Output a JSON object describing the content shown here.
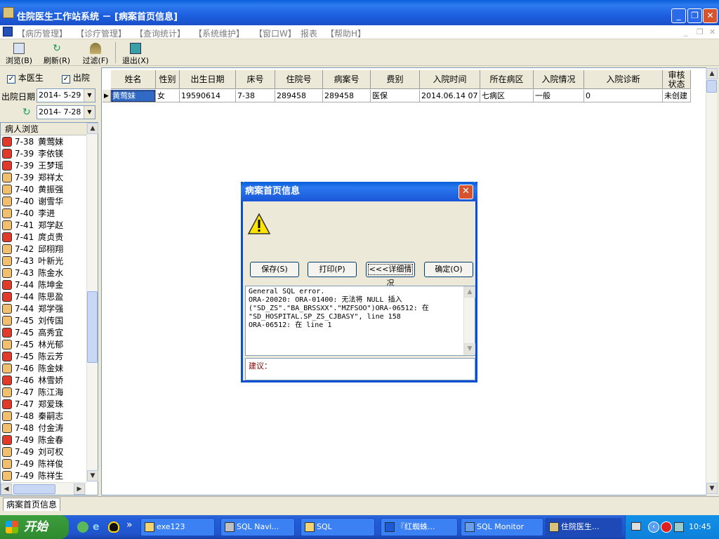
{
  "window": {
    "title": "住院医生工作站系统 － [病案首页信息]"
  },
  "menu": [
    "【病历管理】",
    "【诊疗管理】",
    "【查询统计】",
    "【系统维护】",
    "【窗口W】",
    "报表",
    "【帮助H】"
  ],
  "toolbar": {
    "browse": "浏览(B)",
    "refresh": "刷新(R)",
    "filter": "过滤(F)",
    "exit": "退出(X)"
  },
  "filters": {
    "doctor_label": "本医生",
    "discharge_label": "出院",
    "discharge_date_label": "出院日期",
    "date_from": "2014- 5-29",
    "date_to": "2014- 7-28"
  },
  "patient_list": {
    "header": "病人浏览",
    "items": [
      {
        "bed": "7-38",
        "name": "黄莺妹",
        "sex": "f"
      },
      {
        "bed": "7-39",
        "name": "李依镁",
        "sex": "f"
      },
      {
        "bed": "7-39",
        "name": "王梦瑶",
        "sex": "f"
      },
      {
        "bed": "7-39",
        "name": "郑祥太",
        "sex": "m"
      },
      {
        "bed": "7-40",
        "name": "黄振强",
        "sex": "m"
      },
      {
        "bed": "7-40",
        "name": "谢雪华",
        "sex": "m"
      },
      {
        "bed": "7-40",
        "name": "李进",
        "sex": "m"
      },
      {
        "bed": "7-41",
        "name": "郑学赵",
        "sex": "m"
      },
      {
        "bed": "7-41",
        "name": "庹贞贵",
        "sex": "f"
      },
      {
        "bed": "7-42",
        "name": "邱栩翔",
        "sex": "m"
      },
      {
        "bed": "7-43",
        "name": "叶新光",
        "sex": "m"
      },
      {
        "bed": "7-43",
        "name": "陈金水",
        "sex": "m"
      },
      {
        "bed": "7-44",
        "name": "陈坤金",
        "sex": "f"
      },
      {
        "bed": "7-44",
        "name": "陈思盈",
        "sex": "f"
      },
      {
        "bed": "7-44",
        "name": "郑学强",
        "sex": "m"
      },
      {
        "bed": "7-45",
        "name": "刘传国",
        "sex": "m"
      },
      {
        "bed": "7-45",
        "name": "高秀宜",
        "sex": "f"
      },
      {
        "bed": "7-45",
        "name": "林光郁",
        "sex": "m"
      },
      {
        "bed": "7-45",
        "name": "陈云芳",
        "sex": "f"
      },
      {
        "bed": "7-46",
        "name": "陈金妹",
        "sex": "m"
      },
      {
        "bed": "7-46",
        "name": "林雪娇",
        "sex": "f"
      },
      {
        "bed": "7-47",
        "name": "陈江海",
        "sex": "m"
      },
      {
        "bed": "7-47",
        "name": "郑爱珠",
        "sex": "f"
      },
      {
        "bed": "7-48",
        "name": "秦嗣志",
        "sex": "m"
      },
      {
        "bed": "7-48",
        "name": "付金涛",
        "sex": "m"
      },
      {
        "bed": "7-49",
        "name": "陈金春",
        "sex": "f"
      },
      {
        "bed": "7-49",
        "name": "刘可权",
        "sex": "m"
      },
      {
        "bed": "7-49",
        "name": "陈祥俊",
        "sex": "m"
      },
      {
        "bed": "7-49",
        "name": "陈祥生",
        "sex": "m"
      }
    ]
  },
  "grid": {
    "columns": [
      "姓名",
      "性别",
      "出生日期",
      "床号",
      "住院号",
      "病案号",
      "费别",
      "入院时间",
      "所在病区",
      "入院情况",
      "入院诊断",
      "审核状态"
    ],
    "rows": [
      [
        "黄莺妹",
        "女",
        "19590614",
        "7-38",
        "289458",
        "289458",
        "医保",
        "2014.06.14 07",
        "七病区",
        "一般",
        "0",
        "未创建"
      ]
    ]
  },
  "statusbar": {
    "tab": "病案首页信息"
  },
  "dialog": {
    "title": "病案首页信息",
    "buttons": {
      "save": "保存(S)",
      "print": "打印(P)",
      "details": "<<<详细情况",
      "ok": "确定(O)"
    },
    "error_text": "General SQL error.\nORA-20020: ORA-01400: 无法将 NULL 插入\n(\"SD_ZS\".\"BA_BRSSXX\".\"MZFSOO\")ORA-06512: 在\n\"SD_HOSPITAL.SP_ZS_CJBASY\", line 158\nORA-06512: 在 line 1",
    "suggest_label": "建议："
  },
  "taskbar": {
    "start": "开始",
    "tasks": [
      "exe123",
      "SQL Navi...",
      "SQL",
      "『红蜘蛛...",
      "SQL Monitor",
      "住院医生..."
    ],
    "clock": "10:45"
  },
  "colors": {
    "accent": "#0a5fd8",
    "selection": "#316ac5"
  }
}
